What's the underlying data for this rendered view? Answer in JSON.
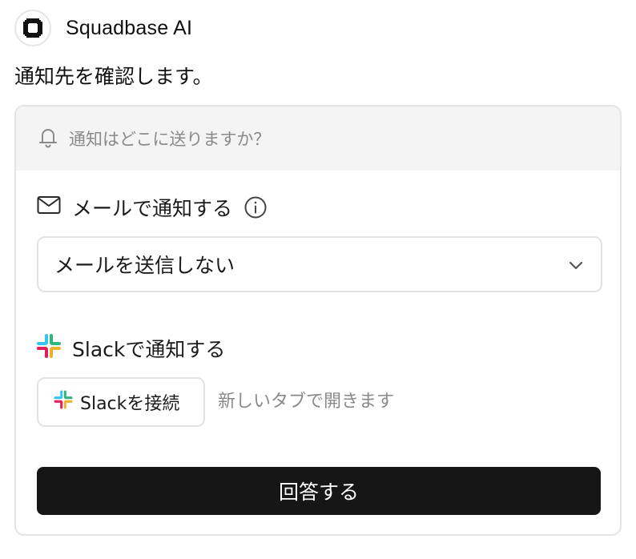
{
  "header": {
    "app_name": "Squadbase AI",
    "logo_icon": "squadbase-logo-icon"
  },
  "message": {
    "text": "通知先を確認します。"
  },
  "card": {
    "question": "通知はどこに送りますか？",
    "question_icon": "bell-icon",
    "email": {
      "label": "メールで通知する",
      "icon": "mail-icon",
      "info_icon": "info-icon",
      "selected_value": "メールを送信しない"
    },
    "slack": {
      "label": "Slackで通知する",
      "icon": "slack-icon",
      "connect_label": "Slackを接続",
      "hint": "新しいタブで開きます"
    },
    "submit_label": "回答する"
  },
  "colors": {
    "slack_blue": "#36C5F0",
    "slack_green": "#2EB67D",
    "slack_red": "#E01E5A",
    "slack_yellow": "#ECB22E",
    "submit_bg": "#161616",
    "muted_text": "#8a8a8a"
  }
}
